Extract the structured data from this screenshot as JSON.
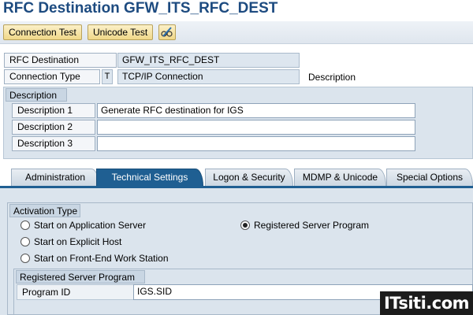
{
  "title": "RFC Destination GFW_ITS_RFC_DEST",
  "toolbar": {
    "connection_test": "Connection Test",
    "unicode_test": "Unicode Test",
    "edit_icon": "pencil-glasses-icon"
  },
  "header": {
    "rfc_destination_label": "RFC Destination",
    "rfc_destination_value": "GFW_ITS_RFC_DEST",
    "connection_type_label": "Connection Type",
    "connection_type_code": "T",
    "connection_type_value": "TCP/IP Connection",
    "description_label": "Description"
  },
  "description": {
    "title": "Description",
    "fields": [
      {
        "label": "Description 1",
        "value": "Generate RFC destination for IGS"
      },
      {
        "label": "Description 2",
        "value": ""
      },
      {
        "label": "Description 3",
        "value": ""
      }
    ]
  },
  "tabs": [
    {
      "label": "Administration",
      "active": false
    },
    {
      "label": "Technical Settings",
      "active": true
    },
    {
      "label": "Logon & Security",
      "active": false
    },
    {
      "label": "MDMP & Unicode",
      "active": false
    },
    {
      "label": "Special Options",
      "active": false
    }
  ],
  "activation": {
    "title": "Activation Type",
    "options": [
      {
        "label": "Start on Application Server",
        "selected": false
      },
      {
        "label": "Start on Explicit Host",
        "selected": false
      },
      {
        "label": "Start on Front-End Work Station",
        "selected": false
      },
      {
        "label": "Registered Server Program",
        "selected": true
      }
    ]
  },
  "registered_server": {
    "title": "Registered Server Program",
    "program_id_label": "Program ID",
    "program_id_value": "IGS.SID"
  },
  "watermark": "ITsiti.com",
  "colors": {
    "title": "#1d4b80",
    "active_tab": "#1f5f92",
    "panel": "#dbe4ed",
    "button": "#f0d889"
  }
}
